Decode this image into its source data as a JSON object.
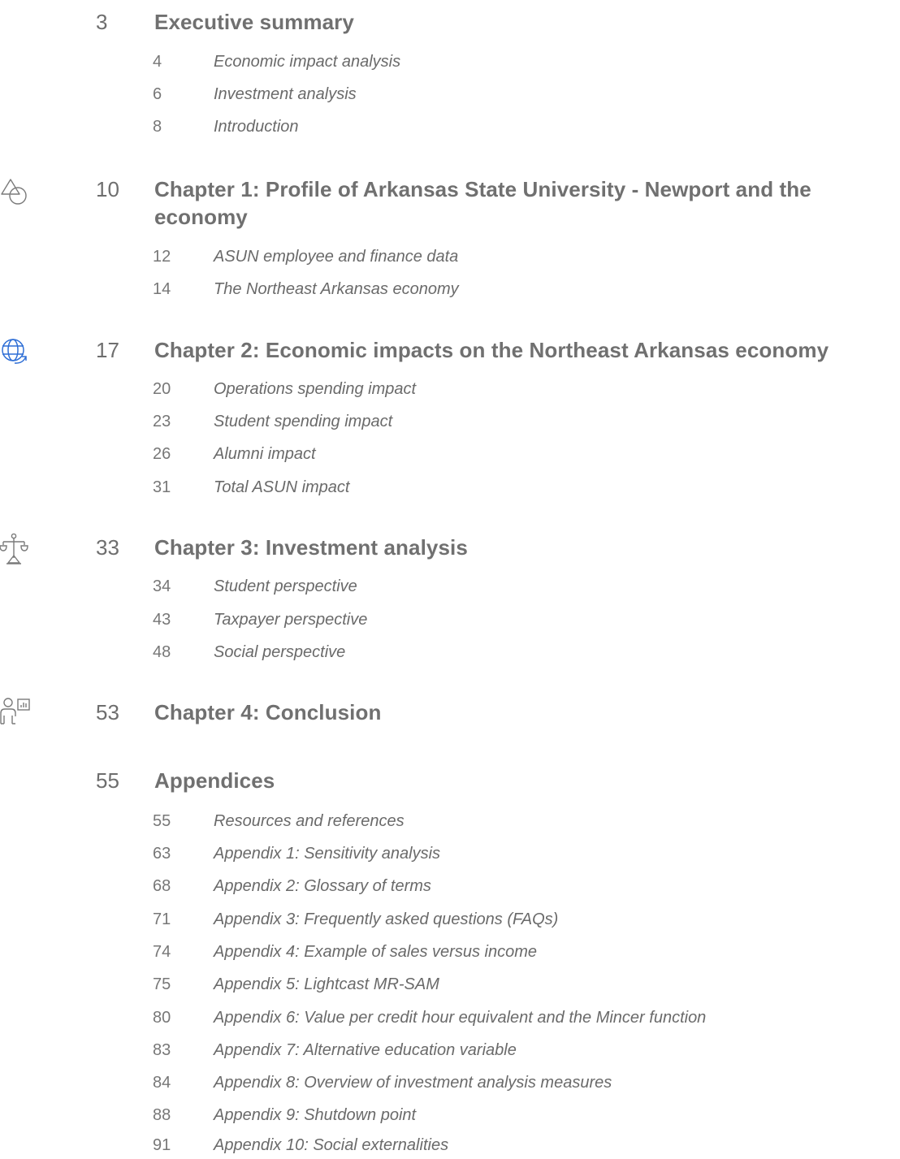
{
  "toc": {
    "sections": [
      {
        "page": "3",
        "title": "Executive summary",
        "icon": "",
        "items": [
          {
            "page": "4",
            "title": "Economic impact analysis"
          },
          {
            "page": "6",
            "title": "Investment analysis"
          },
          {
            "page": "8",
            "title": "Introduction"
          }
        ]
      },
      {
        "page": "10",
        "title": "Chapter 1:  Profile of Arkansas State University - Newport and the economy",
        "icon": "shapes-icon",
        "items": [
          {
            "page": "12",
            "title": "ASUN employee and finance data"
          },
          {
            "page": "14",
            "title": "The Northeast Arkansas economy"
          }
        ]
      },
      {
        "page": "17",
        "title": "Chapter 2:  Economic impacts on the Northeast Arkansas economy",
        "icon": "globe-icon",
        "items": [
          {
            "page": "20",
            "title": "Operations spending impact"
          },
          {
            "page": "23",
            "title": "Student spending impact"
          },
          {
            "page": "26",
            "title": "Alumni impact"
          },
          {
            "page": "31",
            "title": "Total ASUN impact"
          }
        ]
      },
      {
        "page": "33",
        "title": "Chapter 3:  Investment analysis",
        "icon": "scales-icon",
        "items": [
          {
            "page": "34",
            "title": "Student perspective"
          },
          {
            "page": "43",
            "title": "Taxpayer perspective"
          },
          {
            "page": "48",
            "title": "Social perspective"
          }
        ]
      },
      {
        "page": "53",
        "title": "Chapter 4:  Conclusion",
        "icon": "presenter-icon",
        "items": []
      },
      {
        "page": "55",
        "title": "Appendices",
        "icon": "",
        "items": [
          {
            "page": "55",
            "title": "Resources and references"
          },
          {
            "page": "63",
            "title": "Appendix 1:  Sensitivity analysis"
          },
          {
            "page": "68",
            "title": "Appendix 2:  Glossary of terms"
          },
          {
            "page": "71",
            "title": "Appendix 3:  Frequently asked questions (FAQs)"
          },
          {
            "page": "74",
            "title": "Appendix 4:  Example of sales versus income"
          },
          {
            "page": "75",
            "title": "Appendix 5:  Lightcast MR-SAM"
          },
          {
            "page": "80",
            "title": "Appendix 6:  Value per credit hour equivalent and the Mincer function"
          },
          {
            "page": "83",
            "title": "Appendix 7:  Alternative education variable"
          },
          {
            "page": "84",
            "title": "Appendix 8:  Overview of investment analysis measures"
          },
          {
            "page": "88",
            "title": "Appendix 9:  Shutdown point"
          },
          {
            "page": "91",
            "title": "Appendix 10:  Social externalities"
          }
        ]
      }
    ]
  },
  "colors": {
    "text": "#6b6b6b",
    "globe_icon": "#2f6fd6",
    "icon_stroke": "#7a7a7a"
  }
}
